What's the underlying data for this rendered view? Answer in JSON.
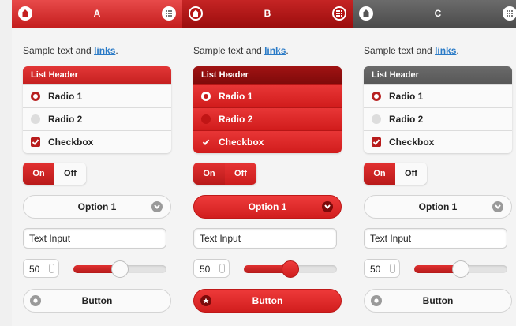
{
  "panels": [
    {
      "title": "A",
      "sample_text": "Sample text and",
      "sample_link": "links",
      "sample_period": ".",
      "list": {
        "header": "List Header",
        "radio1": "Radio 1",
        "radio2": "Radio 2",
        "checkbox": "Checkbox"
      },
      "flip": {
        "on": "On",
        "off": "Off"
      },
      "select": "Option 1",
      "text_input": "Text Input",
      "number_input": "50",
      "slider_value": 0.5,
      "button": "Button"
    },
    {
      "title": "B",
      "sample_text": "Sample text and",
      "sample_link": "links",
      "sample_period": ".",
      "list": {
        "header": "List Header",
        "radio1": "Radio 1",
        "radio2": "Radio 2",
        "checkbox": "Checkbox"
      },
      "flip": {
        "on": "On",
        "off": "Off"
      },
      "select": "Option 1",
      "text_input": "Text Input",
      "number_input": "50",
      "slider_value": 0.5,
      "button": "Button"
    },
    {
      "title": "C",
      "sample_text": "Sample text and",
      "sample_link": "links",
      "sample_period": ".",
      "list": {
        "header": "List Header",
        "radio1": "Radio 1",
        "radio2": "Radio 2",
        "checkbox": "Checkbox"
      },
      "flip": {
        "on": "On",
        "off": "Off"
      },
      "select": "Option 1",
      "text_input": "Text Input",
      "number_input": "50",
      "slider_value": 0.5,
      "button": "Button"
    }
  ],
  "icons": {
    "header_left": "home-icon",
    "header_right": "grid-icon",
    "select_arrow": "chevron-down-icon",
    "button": "star-icon"
  },
  "colors": {
    "accent": "#c41e1e",
    "accent_dark": "#9c0d0d",
    "neutral_header": "#4b4b4b",
    "link": "#2b7bc7"
  }
}
